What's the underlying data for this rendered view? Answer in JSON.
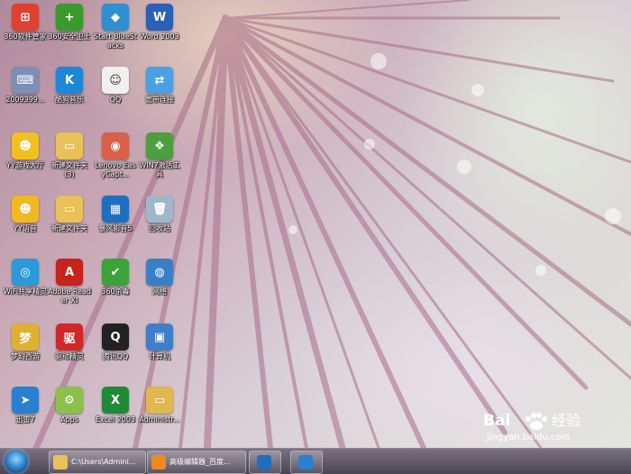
{
  "desktop": {
    "icons": [
      {
        "label": "360软件管家",
        "icon": "360-softmgr-icon",
        "color": "#e04030",
        "glyph": "⊞"
      },
      {
        "label": "360安全卫士",
        "icon": "360-safe-icon",
        "color": "#3a9a2a",
        "glyph": "+"
      },
      {
        "label": "Start BlueStacks",
        "icon": "bluestacks-icon",
        "color": "#2f8fd0",
        "glyph": "◆"
      },
      {
        "label": "Word 2003",
        "icon": "word-icon",
        "color": "#2b5fb8",
        "glyph": "W"
      },
      {
        "label": "2009399...",
        "icon": "keyboard-icon",
        "color": "#7d8fb5",
        "glyph": "⌨"
      },
      {
        "label": "酷狗音乐",
        "icon": "kugou-icon",
        "color": "#1d87d8",
        "glyph": "K"
      },
      {
        "label": "QQ",
        "icon": "qq-shortcut-icon",
        "color": "#f0f0f0",
        "glyph": "☺"
      },
      {
        "label": "宽带连接",
        "icon": "broadband-icon",
        "color": "#4aa0e0",
        "glyph": "⇄"
      },
      {
        "label": "YY游戏大厅",
        "icon": "yy-game-icon",
        "color": "#f2c020",
        "glyph": "☻"
      },
      {
        "label": "新建文件夹 (3)",
        "icon": "folder-icon",
        "color": "#e8c15a",
        "glyph": "▭"
      },
      {
        "label": "Lenovo EasyCapt...",
        "icon": "camera-icon",
        "color": "#d9604a",
        "glyph": "◉"
      },
      {
        "label": "WIN7激活工具",
        "icon": "win7-activate-icon",
        "color": "#4b9f3f",
        "glyph": "❖"
      },
      {
        "label": "YY语音",
        "icon": "yy-voice-icon",
        "color": "#f2b820",
        "glyph": "☻"
      },
      {
        "label": "新建文件夹",
        "icon": "folder-icon",
        "color": "#e8c15a",
        "glyph": "▭"
      },
      {
        "label": "暴风影音5",
        "icon": "baofeng-icon",
        "color": "#1f6fc0",
        "glyph": "▦"
      },
      {
        "label": "回收站",
        "icon": "recycle-bin-icon",
        "color": "#9fb7c9",
        "glyph": "🗑"
      },
      {
        "label": "WiFi共享精灵",
        "icon": "wifi-icon",
        "color": "#2a9ad8",
        "glyph": "◎"
      },
      {
        "label": "Adobe Reader XI",
        "icon": "adobe-reader-icon",
        "color": "#c8221e",
        "glyph": "A"
      },
      {
        "label": "360杀毒",
        "icon": "360-antivirus-icon",
        "color": "#3aa33a",
        "glyph": "✔"
      },
      {
        "label": "网络",
        "icon": "network-icon",
        "color": "#3a7fc4",
        "glyph": "◍"
      },
      {
        "label": "梦幻西游",
        "icon": "menghuan-icon",
        "color": "#e0b030",
        "glyph": "梦"
      },
      {
        "label": "驱动精灵",
        "icon": "driver-genius-icon",
        "color": "#d02828",
        "glyph": "驱"
      },
      {
        "label": "腾讯QQ",
        "icon": "tencent-qq-icon",
        "color": "#222222",
        "glyph": "Q"
      },
      {
        "label": "计算机",
        "icon": "computer-icon",
        "color": "#3f7ec8",
        "glyph": "▣"
      },
      {
        "label": "迅雷7",
        "icon": "xunlei-icon",
        "color": "#2a80d0",
        "glyph": "➤"
      },
      {
        "label": "Apps",
        "icon": "android-apps-icon",
        "color": "#8cc04a",
        "glyph": "⚙"
      },
      {
        "label": "Excel 2003",
        "icon": "excel-icon",
        "color": "#1f8a3a",
        "glyph": "X"
      },
      {
        "label": "Administr...",
        "icon": "user-folder-icon",
        "color": "#e0b850",
        "glyph": "▭"
      }
    ]
  },
  "taskbar": {
    "tasks": [
      {
        "label": "C:\\Users\\Admini...",
        "icon": "explorer-folder-icon",
        "color": "#e8c15a"
      },
      {
        "label": "高级编辑器_百度...",
        "icon": "browser-icon",
        "color": "#f08a20"
      },
      {
        "label": "",
        "icon": "baofeng-task-icon",
        "color": "#1f6fc0"
      },
      {
        "label": "",
        "icon": "xunlei-task-icon",
        "color": "#2a80d0"
      }
    ]
  },
  "watermark": {
    "brand": "Bai",
    "brand2": "经验",
    "url": "jingyan.baidu.com"
  }
}
